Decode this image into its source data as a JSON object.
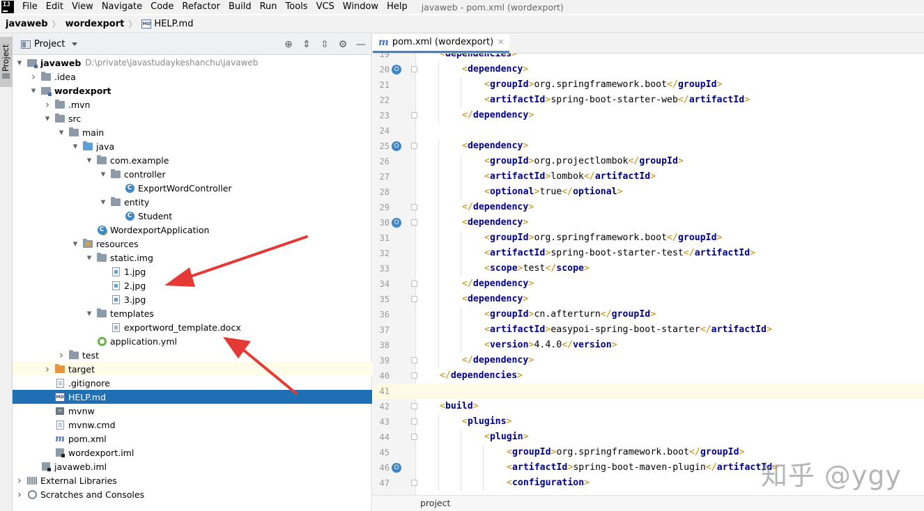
{
  "menubar": {
    "logo": "IJ",
    "items": [
      "File",
      "Edit",
      "View",
      "Navigate",
      "Code",
      "Refactor",
      "Build",
      "Run",
      "Tools",
      "VCS",
      "Window",
      "Help"
    ],
    "window_title": "javaweb - pom.xml (wordexport)"
  },
  "breadcrumb": {
    "items": [
      "javaweb",
      "wordexport",
      "HELP.md"
    ],
    "md_badge": "MD"
  },
  "left_stripe": {
    "label": "Project"
  },
  "project_panel": {
    "title": "Project",
    "tools": [
      "locate-icon",
      "expand-all-icon",
      "collapse-all-icon",
      "gear-icon",
      "minimize-icon"
    ],
    "tree": [
      {
        "label": "javaweb",
        "path": "D:\\private\\javastudaykeshanchu\\javaweb",
        "icon": "module",
        "bold": true,
        "arrow": "down"
      },
      {
        "label": ".idea",
        "icon": "folder",
        "arrow": "right"
      },
      {
        "label": "wordexport",
        "icon": "module",
        "bold": true,
        "arrow": "down"
      },
      {
        "label": ".mvn",
        "icon": "folder",
        "arrow": "right"
      },
      {
        "label": "src",
        "icon": "folder",
        "arrow": "down"
      },
      {
        "label": "main",
        "icon": "folder",
        "arrow": "down"
      },
      {
        "label": "java",
        "icon": "folder-blue",
        "arrow": "down"
      },
      {
        "label": "com.example",
        "icon": "package",
        "arrow": "down"
      },
      {
        "label": "controller",
        "icon": "package",
        "arrow": "down"
      },
      {
        "label": "ExportWordController",
        "icon": "class",
        "arrow": ""
      },
      {
        "label": "entity",
        "icon": "package",
        "arrow": "down"
      },
      {
        "label": "Student",
        "icon": "class",
        "arrow": ""
      },
      {
        "label": "WordexportApplication",
        "icon": "spring-class",
        "arrow": ""
      },
      {
        "label": "resources",
        "icon": "folder-res",
        "arrow": "down"
      },
      {
        "label": "static.img",
        "icon": "folder",
        "arrow": "down"
      },
      {
        "label": "1.jpg",
        "icon": "image",
        "arrow": ""
      },
      {
        "label": "2.jpg",
        "icon": "image",
        "arrow": ""
      },
      {
        "label": "3.jpg",
        "icon": "image",
        "arrow": ""
      },
      {
        "label": "templates",
        "icon": "folder",
        "arrow": "down"
      },
      {
        "label": "exportword_template.docx",
        "icon": "doc",
        "arrow": ""
      },
      {
        "label": "application.yml",
        "icon": "yml",
        "arrow": ""
      },
      {
        "label": "test",
        "icon": "folder",
        "arrow": "right"
      },
      {
        "label": "target",
        "icon": "folder-orange",
        "arrow": "right",
        "excluded": true
      },
      {
        "label": ".gitignore",
        "icon": "file",
        "arrow": ""
      },
      {
        "label": "HELP.md",
        "icon": "md",
        "arrow": "",
        "selected": true
      },
      {
        "label": "mvnw",
        "icon": "terminal",
        "arrow": ""
      },
      {
        "label": "mvnw.cmd",
        "icon": "file",
        "arrow": ""
      },
      {
        "label": "pom.xml",
        "icon": "maven",
        "arrow": ""
      },
      {
        "label": "wordexport.iml",
        "icon": "iml",
        "arrow": ""
      },
      {
        "label": "javaweb.iml",
        "icon": "iml",
        "arrow": ""
      },
      {
        "label": "External Libraries",
        "icon": "library",
        "arrow": "right"
      },
      {
        "label": "Scratches and Consoles",
        "icon": "scratch",
        "arrow": "right"
      }
    ]
  },
  "editor": {
    "tab_label": "pom.xml (wordexport)",
    "tab_icon_glyph": "m",
    "status_text": "project",
    "lines": [
      {
        "n": "20",
        "indent": 1,
        "kind": "open",
        "tag": "dependency",
        "marker": true
      },
      {
        "n": "21",
        "indent": 2,
        "kind": "elem",
        "tag": "groupId",
        "text": "org.springframework.boot"
      },
      {
        "n": "22",
        "indent": 2,
        "kind": "elem",
        "tag": "artifactId",
        "text": "spring-boot-starter-web"
      },
      {
        "n": "23",
        "indent": 1,
        "kind": "close",
        "tag": "dependency"
      },
      {
        "n": "24",
        "indent": 0,
        "kind": "blank"
      },
      {
        "n": "25",
        "indent": 1,
        "kind": "open",
        "tag": "dependency",
        "marker": true
      },
      {
        "n": "26",
        "indent": 2,
        "kind": "elem",
        "tag": "groupId",
        "text": "org.projectlombok"
      },
      {
        "n": "27",
        "indent": 2,
        "kind": "elem",
        "tag": "artifactId",
        "text": "lombok"
      },
      {
        "n": "28",
        "indent": 2,
        "kind": "elem",
        "tag": "optional",
        "text": "true"
      },
      {
        "n": "29",
        "indent": 1,
        "kind": "close",
        "tag": "dependency"
      },
      {
        "n": "30",
        "indent": 1,
        "kind": "open",
        "tag": "dependency",
        "marker": true
      },
      {
        "n": "31",
        "indent": 2,
        "kind": "elem",
        "tag": "groupId",
        "text": "org.springframework.boot"
      },
      {
        "n": "32",
        "indent": 2,
        "kind": "elem",
        "tag": "artifactId",
        "text": "spring-boot-starter-test"
      },
      {
        "n": "33",
        "indent": 2,
        "kind": "elem",
        "tag": "scope",
        "text": "test"
      },
      {
        "n": "34",
        "indent": 1,
        "kind": "close",
        "tag": "dependency"
      },
      {
        "n": "35",
        "indent": 1,
        "kind": "open",
        "tag": "dependency"
      },
      {
        "n": "36",
        "indent": 2,
        "kind": "elem",
        "tag": "groupId",
        "text": "cn.afterturn"
      },
      {
        "n": "37",
        "indent": 2,
        "kind": "elem",
        "tag": "artifactId",
        "text": "easypoi-spring-boot-starter"
      },
      {
        "n": "38",
        "indent": 2,
        "kind": "elem",
        "tag": "version",
        "text": "4.4.0"
      },
      {
        "n": "39",
        "indent": 1,
        "kind": "close",
        "tag": "dependency"
      },
      {
        "n": "40",
        "indent": 0,
        "kind": "close",
        "tag": "dependencies"
      },
      {
        "n": "41",
        "indent": 0,
        "kind": "blank",
        "current": true
      },
      {
        "n": "42",
        "indent": 0,
        "kind": "open",
        "tag": "build"
      },
      {
        "n": "43",
        "indent": 1,
        "kind": "open",
        "tag": "plugins"
      },
      {
        "n": "44",
        "indent": 2,
        "kind": "open",
        "tag": "plugin"
      },
      {
        "n": "45",
        "indent": 3,
        "kind": "elem",
        "tag": "groupId",
        "text": "org.springframework.boot"
      },
      {
        "n": "46",
        "indent": 3,
        "kind": "elem",
        "tag": "artifactId",
        "text": "spring-boot-maven-plugin",
        "marker": true
      },
      {
        "n": "47",
        "indent": 3,
        "kind": "open",
        "tag": "configuration"
      }
    ],
    "partial_top_line": {
      "n": "19",
      "tag": "dependencies"
    }
  },
  "watermark": "知乎 @ygy",
  "colors": {
    "selection": "#1f6fb5",
    "tag": "#000080",
    "bracket": "#c88a00",
    "arrow": "#e53935"
  }
}
